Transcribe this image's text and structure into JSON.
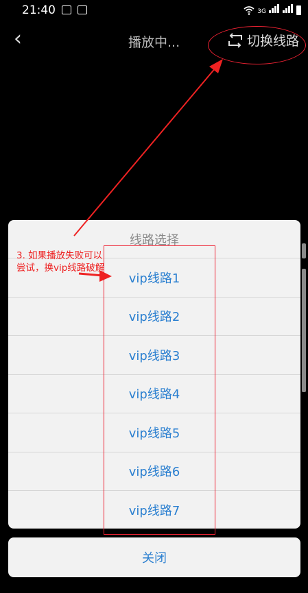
{
  "status_bar": {
    "time": "21:40",
    "network": "3G"
  },
  "nav": {
    "title": "播放中...",
    "switch_label": "切换线路"
  },
  "sheet": {
    "header": "线路选择",
    "options": [
      "vip线路1",
      "vip线路2",
      "vip线路3",
      "vip线路4",
      "vip线路5",
      "vip线路6",
      "vip线路7"
    ]
  },
  "close_label": "关闭",
  "annotation": {
    "text": "3. 如果播放失败可以尝试，换vip线路破解"
  },
  "colors": {
    "accent": "#2a7fd0",
    "annotation": "#e22222",
    "sheet_bg": "#f2f2f2"
  }
}
